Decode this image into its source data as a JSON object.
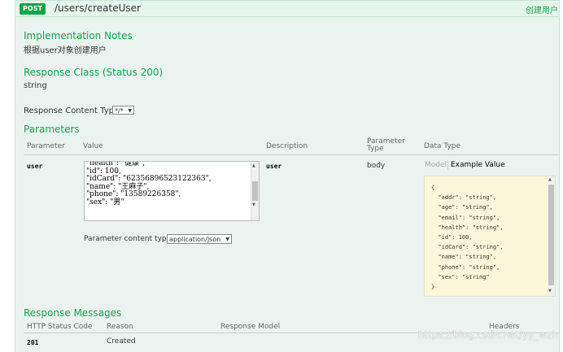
{
  "endpoint": {
    "method": "POST",
    "path": "/users/createUser",
    "summary": "创建用户"
  },
  "implementation_notes": {
    "title": "Implementation Notes",
    "text": "根据user对象创建用户"
  },
  "response_class": {
    "title": "Response Class (Status 200)",
    "value": "string"
  },
  "response_content_type": {
    "label": "Response Content Type",
    "selected": "*/*"
  },
  "parameters": {
    "title": "Parameters",
    "headers": {
      "parameter": "Parameter",
      "value": "Value",
      "description": "Description",
      "parameter_type": "Parameter Type",
      "data_type": "Data Type"
    },
    "rows": [
      {
        "name": "user",
        "value_lines": [
          "\"health\": \"健康\",",
          "\"id\": 100,",
          "\"idCard\": \"62356896523122363\",",
          "\"name\": \"王麻子\",",
          "\"phone\": \"13589226358\",",
          "\"sex\": \"男\"",
          "}"
        ],
        "description": "user",
        "parameter_type": "body",
        "model_tab": "Model",
        "example_tab": "Example Value",
        "example_lines": [
          "{",
          "  \"addr\": \"string\",",
          "  \"age\": \"string\",",
          "  \"email\": \"string\",",
          "  \"health\": \"string\",",
          "  \"id\": 100,",
          "  \"idCard\": \"string\",",
          "  \"name\": \"string\",",
          "  \"phone\": \"string\",",
          "  \"sex\": \"string\"",
          "}"
        ]
      }
    ],
    "content_type_label": "Parameter content type:",
    "content_type_selected": "application/json"
  },
  "response_messages": {
    "title": "Response Messages",
    "headers": {
      "status_code": "HTTP Status Code",
      "reason": "Reason",
      "response_model": "Response Model",
      "headers": "Headers"
    },
    "rows": [
      {
        "code": "201",
        "reason": "Created"
      }
    ]
  },
  "watermark": "https://blog.csdn.net/yy_wzh",
  "colors": {
    "accent": "#10a54a",
    "panel": "#ebf3f0",
    "example_bg": "#fcf6db"
  }
}
